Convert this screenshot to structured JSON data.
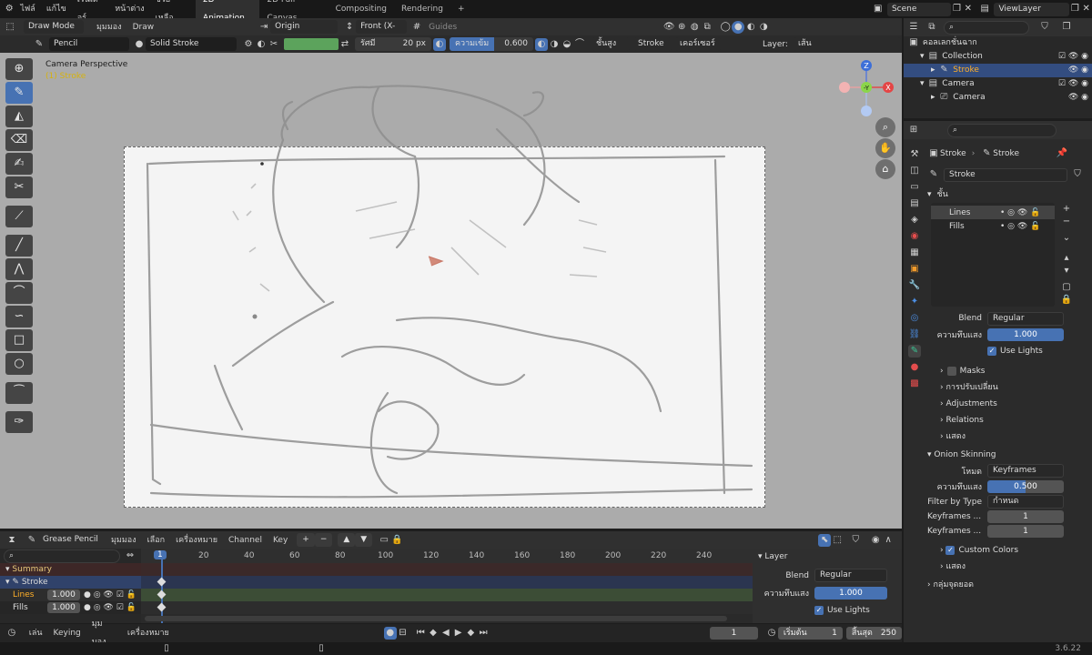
{
  "topbar": {
    "menus": [
      "ไฟล์",
      "แก้ไข",
      "เรนเดอร์",
      "หน้าต่าง",
      "ช่วยเหลือ"
    ],
    "workspaces": [
      "2D Animation",
      "2D Full Canvas",
      "Compositing",
      "Rendering"
    ],
    "active_workspace": "2D Animation",
    "plus": "+",
    "scene": "Scene",
    "viewlayer": "ViewLayer"
  },
  "viewport_header": {
    "mode": "Draw Mode",
    "menus": [
      "มุมมอง",
      "Draw"
    ],
    "origin": "Origin",
    "projection": "Front (X-Z)",
    "guides": "Guides"
  },
  "tool_settings": {
    "brush": "Pencil",
    "material": "Solid Stroke",
    "radius_label": "รัศมี",
    "radius_value": "20 px",
    "strength_label": "ความเข้ม",
    "strength_value": "0.600",
    "stroke_placement": "ชั้นสูง",
    "stroke": "Stroke",
    "cursor": "เคอร์เซอร์",
    "layer_label": "Layer:",
    "layer_value": "เส้น",
    "color_hex": "#5ca35c"
  },
  "viewport": {
    "title": "Camera Perspective",
    "subtitle": "(1) Stroke",
    "gizmo": {
      "z": "Z",
      "y": "-Y",
      "x": "X"
    }
  },
  "outliner": {
    "search_placeholder": "",
    "items": [
      {
        "label": "คอลเลกชั่นฉาก",
        "indent": 0
      },
      {
        "label": "Collection",
        "indent": 1
      },
      {
        "label": "Stroke",
        "indent": 2,
        "selected": true
      },
      {
        "label": "Camera",
        "indent": 1
      },
      {
        "label": "Camera",
        "indent": 2
      }
    ]
  },
  "properties": {
    "breadcrumb_1": "Stroke",
    "breadcrumb_2": "Stroke",
    "object_name": "Stroke",
    "layers_header": "ชั้น",
    "layers": [
      "Lines",
      "Fills"
    ],
    "blend_label": "Blend",
    "blend_value": "Regular",
    "opacity_label": "ความทึบแสง",
    "opacity_value": "1.000",
    "use_lights": "Use Lights",
    "subpanels": [
      "Masks",
      "การปรับเปลี่ยน",
      "Adjustments",
      "Relations",
      "แสดง"
    ],
    "onion_header": "Onion Skinning",
    "onion_mode_label": "โหมด",
    "onion_mode_value": "Keyframes",
    "onion_opacity_label": "ความทึบแสง",
    "onion_opacity_value": "0.500",
    "filter_label": "Filter by Type",
    "filter_value": "กำหนด",
    "kf_before_label": "Keyframes ...",
    "kf_before_value": "1",
    "kf_after_label": "Keyframes ...",
    "kf_after_value": "1",
    "custom_colors": "Custom Colors",
    "display": "แสดง",
    "vertex_groups": "กลุ่มจุดยอด"
  },
  "timeline": {
    "editor": "Grease Pencil",
    "menus": [
      "มุมมอง",
      "เลือก",
      "เครื่องหมาย",
      "Channel",
      "Key"
    ],
    "channels": [
      {
        "label": "Summary",
        "value": ""
      },
      {
        "label": "Stroke",
        "value": ""
      },
      {
        "label": "Lines",
        "value": "1.000"
      },
      {
        "label": "Fills",
        "value": "1.000"
      }
    ],
    "frames": [
      "1",
      "20",
      "40",
      "60",
      "80",
      "100",
      "120",
      "140",
      "160",
      "180",
      "200",
      "220",
      "240"
    ],
    "panel_title": "Layer",
    "panel_blend_label": "Blend",
    "panel_blend_value": "Regular",
    "panel_opacity_label": "ความทึบแสง",
    "panel_opacity_value": "1.000",
    "panel_use_lights": "Use Lights"
  },
  "playbar": {
    "play_menu": "เล่น",
    "keying": "Keying",
    "view": "มุมมอง",
    "markers": "เครื่องหมาย",
    "current_frame": "1",
    "start_label": "เริ่มต้น",
    "start_value": "1",
    "end_label": "สิ้นสุด",
    "end_value": "250"
  },
  "status": {
    "version": "3.6.22"
  }
}
